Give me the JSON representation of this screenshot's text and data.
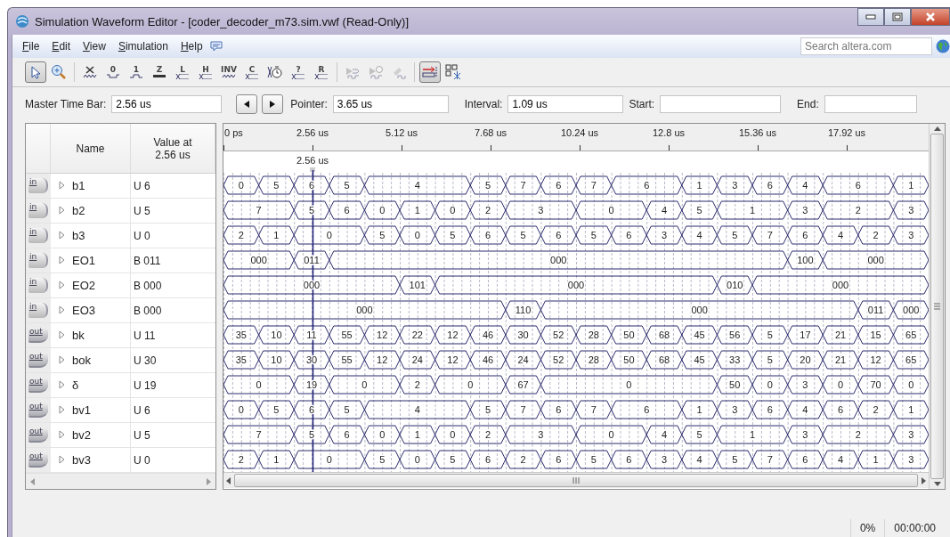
{
  "window": {
    "title": "Simulation Waveform Editor - [coder_decoder_m73.sim.vwf (Read-Only)]"
  },
  "menu": [
    {
      "label": "File"
    },
    {
      "label": "Edit"
    },
    {
      "label": "View"
    },
    {
      "label": "Simulation"
    },
    {
      "label": "Help"
    }
  ],
  "search": {
    "placeholder": "Search altera.com"
  },
  "toolbar": [
    [
      {
        "kind": "select",
        "selected": true,
        "disabled": false
      },
      {
        "kind": "zoom",
        "selected": false,
        "disabled": false
      }
    ],
    [
      {
        "kind": "unknown",
        "selected": false,
        "disabled": false
      },
      {
        "kind": "low",
        "glyph": "0",
        "selected": false,
        "disabled": false
      },
      {
        "kind": "high",
        "glyph": "1",
        "selected": false,
        "disabled": false
      },
      {
        "kind": "high-impedance",
        "glyph": "Z",
        "selected": false,
        "disabled": false
      },
      {
        "kind": "bus",
        "glyph": "L",
        "selected": false,
        "disabled": false
      },
      {
        "kind": "bus",
        "glyph": "H",
        "selected": false,
        "disabled": false
      },
      {
        "kind": "invert",
        "glyph": "INV",
        "selected": false,
        "disabled": false
      },
      {
        "kind": "bus",
        "glyph": "C",
        "selected": false,
        "disabled": false
      },
      {
        "kind": "clock",
        "selected": false,
        "disabled": false
      },
      {
        "kind": "bus",
        "glyph": "?",
        "selected": false,
        "disabled": false
      },
      {
        "kind": "bus",
        "glyph": "R",
        "selected": false,
        "disabled": false
      }
    ],
    [
      {
        "kind": "run",
        "selected": false,
        "disabled": true
      },
      {
        "kind": "run-timing",
        "selected": false,
        "disabled": true
      },
      {
        "kind": "generate",
        "selected": false,
        "disabled": true
      }
    ],
    [
      {
        "kind": "snap",
        "selected": true,
        "disabled": false
      },
      {
        "kind": "grouping",
        "selected": false,
        "disabled": false
      }
    ]
  ],
  "time_bar": {
    "master_label": "Master Time Bar:",
    "master": "2.56 us",
    "pointer_label": "Pointer:",
    "pointer": "3.65 us",
    "interval_label": "Interval:",
    "interval": "1.09 us",
    "start_label": "Start:",
    "end_label": "End:"
  },
  "table": {
    "columns": [
      "Name",
      "Value at 2.56 us"
    ]
  },
  "ruler": {
    "labels": [
      "0 ps",
      "2.56 us",
      "5.12 us",
      "7.68 us",
      "10.24 us",
      "12.8 us",
      "15.36 us",
      "17.92 us"
    ],
    "cursor": "2.56 us"
  },
  "signals": [
    {
      "kind": "input",
      "badge": "in",
      "name": "b1",
      "expanded": false,
      "value": "U 6",
      "segments": [
        "0",
        "5",
        "6",
        "5",
        "4",
        "5",
        "7",
        "6",
        "7",
        "6",
        "1",
        "3",
        "6",
        "4",
        "6",
        "1"
      ]
    },
    {
      "kind": "input",
      "badge": "in",
      "name": "b2",
      "expanded": false,
      "value": "U 5",
      "segments": [
        "7",
        "5",
        "6",
        "0",
        "1",
        "0",
        "2",
        "3",
        "0",
        "4",
        "5",
        "1",
        "3",
        "2",
        "3"
      ]
    },
    {
      "kind": "input",
      "badge": "in",
      "name": "b3",
      "expanded": false,
      "value": "U 0",
      "segments": [
        "2",
        "1",
        "0",
        "5",
        "0",
        "5",
        "6",
        "5",
        "6",
        "5",
        "6",
        "3",
        "4",
        "5",
        "7",
        "6",
        "4",
        "2",
        "3"
      ]
    },
    {
      "kind": "input",
      "badge": "in",
      "name": "EO1",
      "expanded": false,
      "value": "B 011",
      "segments": [
        "000",
        "011",
        "000",
        "100",
        "000"
      ]
    },
    {
      "kind": "input",
      "badge": "in",
      "name": "EO2",
      "expanded": false,
      "value": "B 000",
      "segments": [
        "000",
        "101",
        "000",
        "010",
        "000"
      ]
    },
    {
      "kind": "input",
      "badge": "in",
      "name": "EO3",
      "expanded": false,
      "value": "B 000",
      "segments": [
        "000",
        "110",
        "000",
        "011",
        "000"
      ]
    },
    {
      "kind": "output",
      "badge": "out",
      "name": "bk",
      "expanded": false,
      "value": "U 11",
      "segments": [
        "35",
        "10",
        "11",
        "55",
        "12",
        "22",
        "12",
        "46",
        "30",
        "52",
        "28",
        "50",
        "68",
        "45",
        "56",
        "5",
        "17",
        "21",
        "15",
        "65"
      ]
    },
    {
      "kind": "output",
      "badge": "out",
      "name": "bok",
      "expanded": false,
      "value": "U 30",
      "segments": [
        "35",
        "10",
        "30",
        "55",
        "12",
        "24",
        "12",
        "46",
        "24",
        "52",
        "28",
        "50",
        "68",
        "45",
        "33",
        "5",
        "20",
        "21",
        "12",
        "65"
      ]
    },
    {
      "kind": "output",
      "badge": "out",
      "name": "δ",
      "expanded": false,
      "value": "U 19",
      "segments": [
        "0",
        "19",
        "0",
        "2",
        "0",
        "67",
        "0",
        "50",
        "0",
        "3",
        "0",
        "70",
        "0"
      ]
    },
    {
      "kind": "output",
      "badge": "out",
      "name": "bv1",
      "expanded": false,
      "value": "U 6",
      "segments": [
        "0",
        "5",
        "6",
        "5",
        "4",
        "5",
        "7",
        "6",
        "7",
        "6",
        "1",
        "3",
        "6",
        "4",
        "6",
        "2",
        "1"
      ]
    },
    {
      "kind": "output",
      "badge": "out",
      "name": "bv2",
      "expanded": false,
      "value": "U 5",
      "segments": [
        "7",
        "5",
        "6",
        "0",
        "1",
        "0",
        "2",
        "3",
        "0",
        "4",
        "5",
        "1",
        "3",
        "2",
        "3"
      ]
    },
    {
      "kind": "output",
      "badge": "out",
      "name": "bv3",
      "expanded": false,
      "value": "U 0",
      "segments": [
        "2",
        "1",
        "0",
        "5",
        "0",
        "5",
        "6",
        "2",
        "6",
        "5",
        "6",
        "3",
        "4",
        "5",
        "7",
        "6",
        "4",
        "1",
        "3"
      ]
    }
  ],
  "status_bar": {
    "progress": "0%",
    "elapsed": "00:00:00"
  }
}
